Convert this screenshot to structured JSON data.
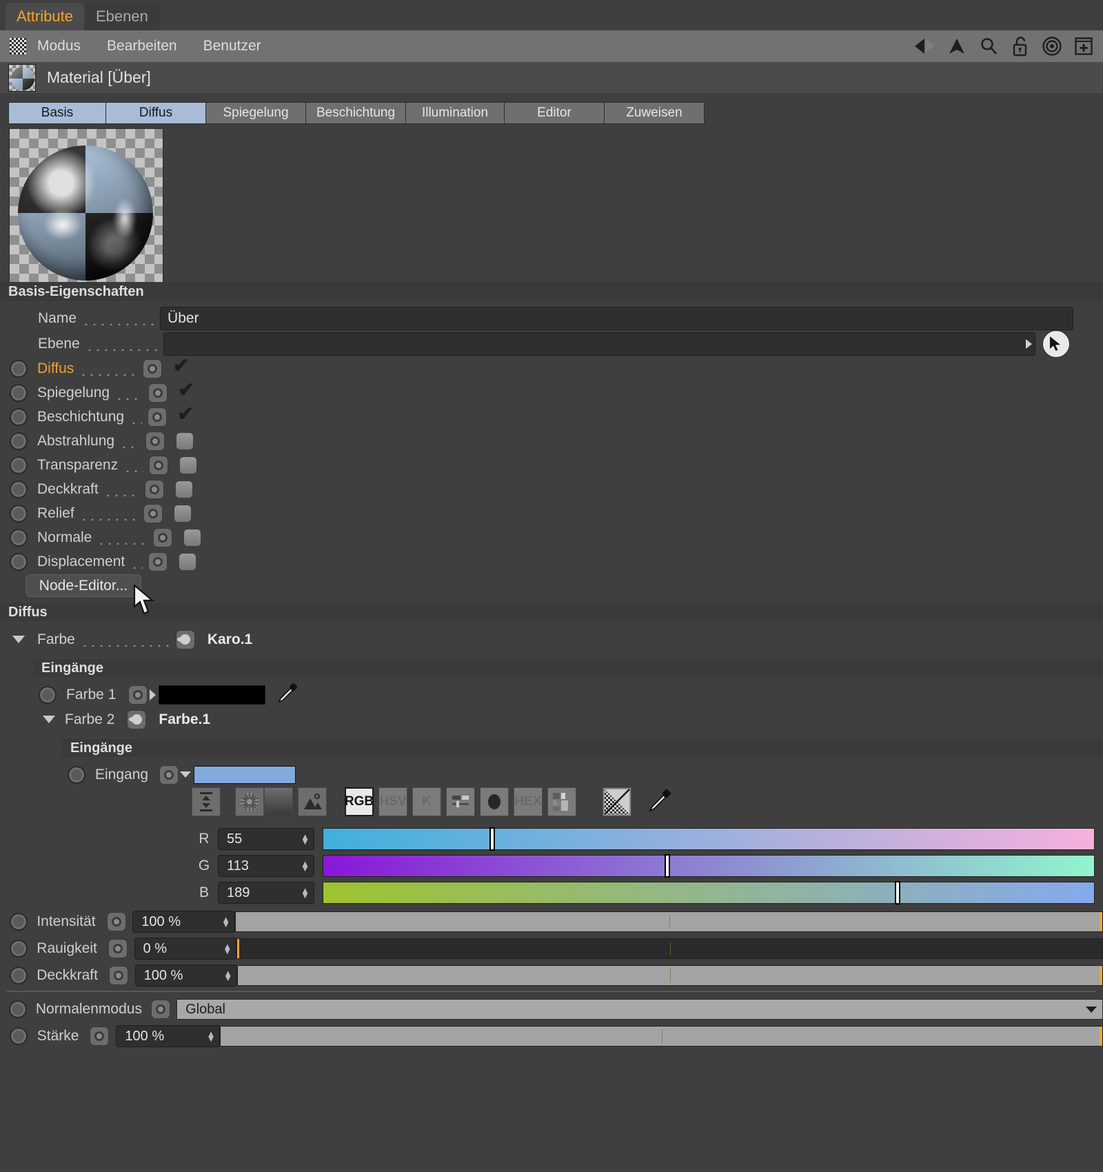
{
  "panel_tabs": [
    {
      "label": "Attribute",
      "active": true
    },
    {
      "label": "Ebenen",
      "active": false
    }
  ],
  "menubar": {
    "grip_icon": "grip-checker-icon",
    "items": [
      "Modus",
      "Bearbeiten",
      "Benutzer"
    ],
    "right_icons": [
      "back-arrow-icon",
      "up-arrow-icon",
      "search-icon",
      "unlock-icon",
      "target-icon",
      "add-panel-icon"
    ]
  },
  "object_header": {
    "thumb_icon": "material-sphere-icon",
    "title": "Material [Über]"
  },
  "material_tabs": [
    {
      "label": "Basis",
      "selected": true
    },
    {
      "label": "Diffus",
      "selected": true
    },
    {
      "label": "Spiegelung",
      "selected": false
    },
    {
      "label": "Beschichtung",
      "selected": false
    },
    {
      "label": "Illumination",
      "selected": false
    },
    {
      "label": "Editor",
      "selected": false
    },
    {
      "label": "Zuweisen",
      "selected": false
    }
  ],
  "preview": {
    "icon": "material-preview-sphere"
  },
  "basis": {
    "header": "Basis-Eigenschaften",
    "name_label": "Name",
    "name_value": "Über",
    "ebene_label": "Ebene",
    "ebene_value": "",
    "channels": [
      {
        "label": "Diffus",
        "accent": true,
        "checked": true
      },
      {
        "label": "Spiegelung",
        "accent": false,
        "checked": true
      },
      {
        "label": "Beschichtung",
        "accent": false,
        "checked": true
      },
      {
        "label": "Abstrahlung",
        "accent": false,
        "checked": false
      },
      {
        "label": "Transparenz",
        "accent": false,
        "checked": false
      },
      {
        "label": "Deckkraft",
        "accent": false,
        "checked": false
      },
      {
        "label": "Relief",
        "accent": false,
        "checked": false
      },
      {
        "label": "Normale",
        "accent": false,
        "checked": false
      },
      {
        "label": "Displacement",
        "accent": false,
        "checked": false
      }
    ],
    "node_editor_button": "Node-Editor..."
  },
  "diffus": {
    "header": "Diffus",
    "farbe_label": "Farbe",
    "farbe_node": "Karo.1",
    "eingaenge_header_1": "Eingänge",
    "farbe1_label": "Farbe 1",
    "farbe1_color": "#000000",
    "farbe1_picker_icon": "eyedropper-icon",
    "farbe2_label": "Farbe 2",
    "farbe2_node": "Farbe.1",
    "eingaenge_header_2": "Eingänge",
    "eingang_label": "Eingang",
    "eingang_color": "#82aade",
    "color_toolbar": {
      "left_icons": [
        "compress-icon",
        "color-wheel-icon",
        "gradient-icon",
        "image-picker-icon"
      ],
      "modes": [
        {
          "label": "RGB",
          "active": true
        },
        {
          "label": "HSV",
          "active": false
        },
        {
          "label": "K",
          "active": false
        },
        {
          "label": "SLIDERS",
          "active": false,
          "icon": "mixer-sliders-icon"
        },
        {
          "label": "DOT",
          "active": false,
          "icon": "filled-circle-icon"
        },
        {
          "label": "HEX",
          "active": false
        },
        {
          "label": "SWATCH",
          "active": false,
          "icon": "swatch-grid-icon"
        }
      ],
      "right_icons": [
        "alpha-checker-icon",
        "eyedropper-icon"
      ]
    },
    "rgb": [
      {
        "label": "R",
        "value": "55",
        "num": 55,
        "grad_from": "#3fb0dd",
        "grad_to": "#f7b0dd"
      },
      {
        "label": "G",
        "value": "113",
        "num": 113,
        "grad_from": "#8a17d8",
        "grad_to": "#90f5cd"
      },
      {
        "label": "B",
        "value": "189",
        "num": 189,
        "grad_from": "#9ec32e",
        "grad_to": "#86a9ee"
      }
    ],
    "params": [
      {
        "label": "Intensität",
        "value": "100 %",
        "pct": 100
      },
      {
        "label": "Rauigkeit",
        "value": "0 %",
        "pct": 0
      },
      {
        "label": "Deckkraft",
        "value": "100 %",
        "pct": 100
      }
    ],
    "normalenmodus_label": "Normalenmodus",
    "normalenmodus_value": "Global",
    "staerke_label": "Stärke",
    "staerke_value": "100 %",
    "staerke_pct": 100
  },
  "colors": {
    "accent": "#f0a02c",
    "tab_selected": "#a8bcd8",
    "panel_bg": "#4b4b4b",
    "group_bg": "#3a3a3a",
    "slider_handle": "#f2a43a"
  }
}
